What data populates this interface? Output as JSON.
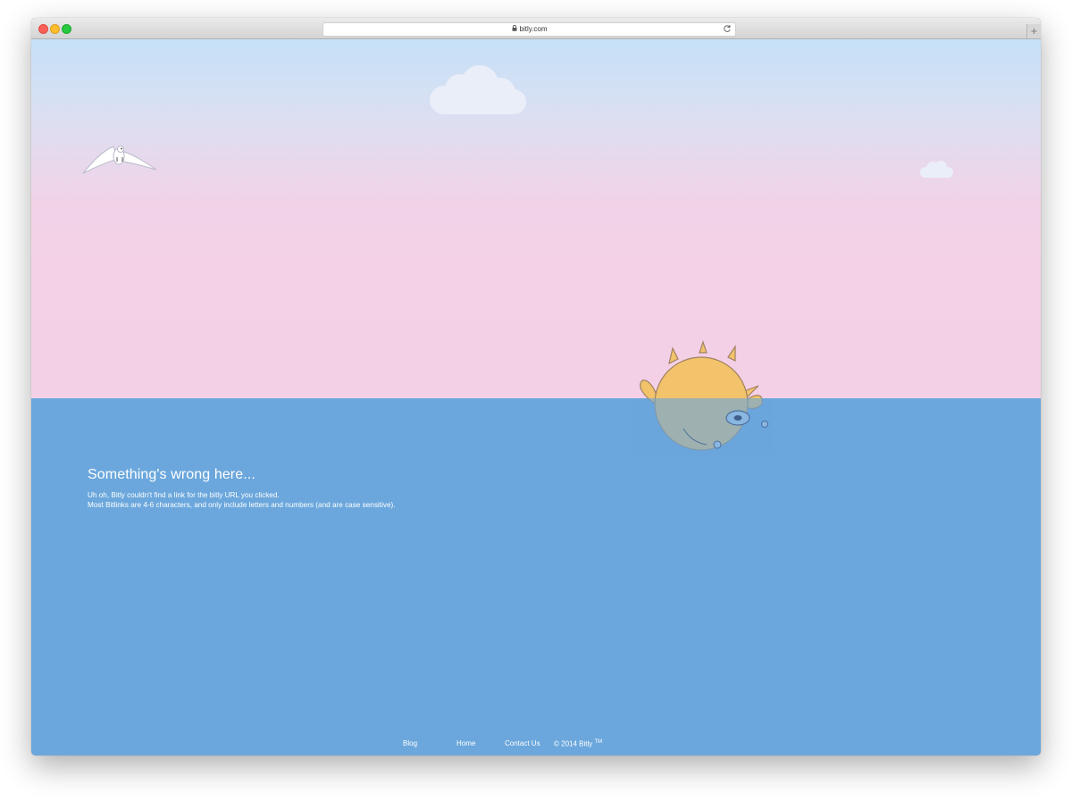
{
  "browser": {
    "url": "bitly.com"
  },
  "error": {
    "heading": "Something's wrong here...",
    "line1": "Uh oh, Bitly couldn't find a link for the bitly URL you clicked.",
    "line2": "Most Bitlinks are 4-6 characters, and only include letters and numbers (and are case sensitive)."
  },
  "footer": {
    "links": [
      "Blog",
      "Home",
      "Contact Us"
    ],
    "copyright": "© 2014 Bitly",
    "trademark": "TM"
  },
  "icons": [
    "lock-icon",
    "reload-icon",
    "plus-icon",
    "cloud",
    "seagull",
    "pufferfish"
  ],
  "colors": {
    "sky_top": "#c5e1f8",
    "sky_pink": "#f4d1e6",
    "sea": "#6ba7dc",
    "pufferfish": "#f2c36a"
  }
}
